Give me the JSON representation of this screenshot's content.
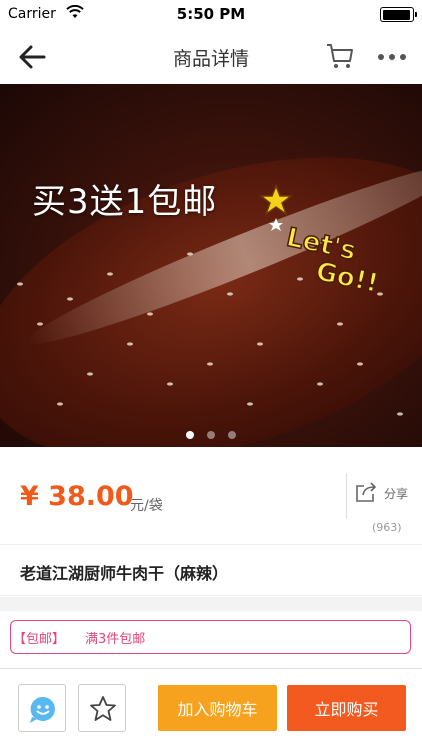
{
  "status_bar": {
    "carrier": "Carrier",
    "time": "5:50 PM",
    "icons": [
      "wifi-icon",
      "battery-icon"
    ]
  },
  "nav": {
    "title": "商品详情",
    "icons": [
      "back-arrow-icon",
      "cart-icon",
      "more-icon"
    ]
  },
  "hero": {
    "promo_text": "买3送1包邮",
    "sticker_text": "Let's Go!!",
    "dots_count": 3,
    "active_dot": 0
  },
  "price": {
    "value": "¥ 38.00",
    "unit": "元/袋",
    "share_label": "分享",
    "share_count": "(963)"
  },
  "product": {
    "title": "老道江湖厨师牛肉干（麻辣）"
  },
  "promotion": {
    "tag": "【包邮】",
    "text": "满3件包邮"
  },
  "bottom_bar": {
    "add_to_cart": "加入购物车",
    "buy_now": "立即购买",
    "icons": [
      "chat-icon",
      "star-icon"
    ]
  },
  "colors": {
    "accent_orange": "#f05a1a",
    "cart_button": "#f6a21f",
    "buy_button": "#f25a1f",
    "promo_pink": "#e4467a"
  }
}
